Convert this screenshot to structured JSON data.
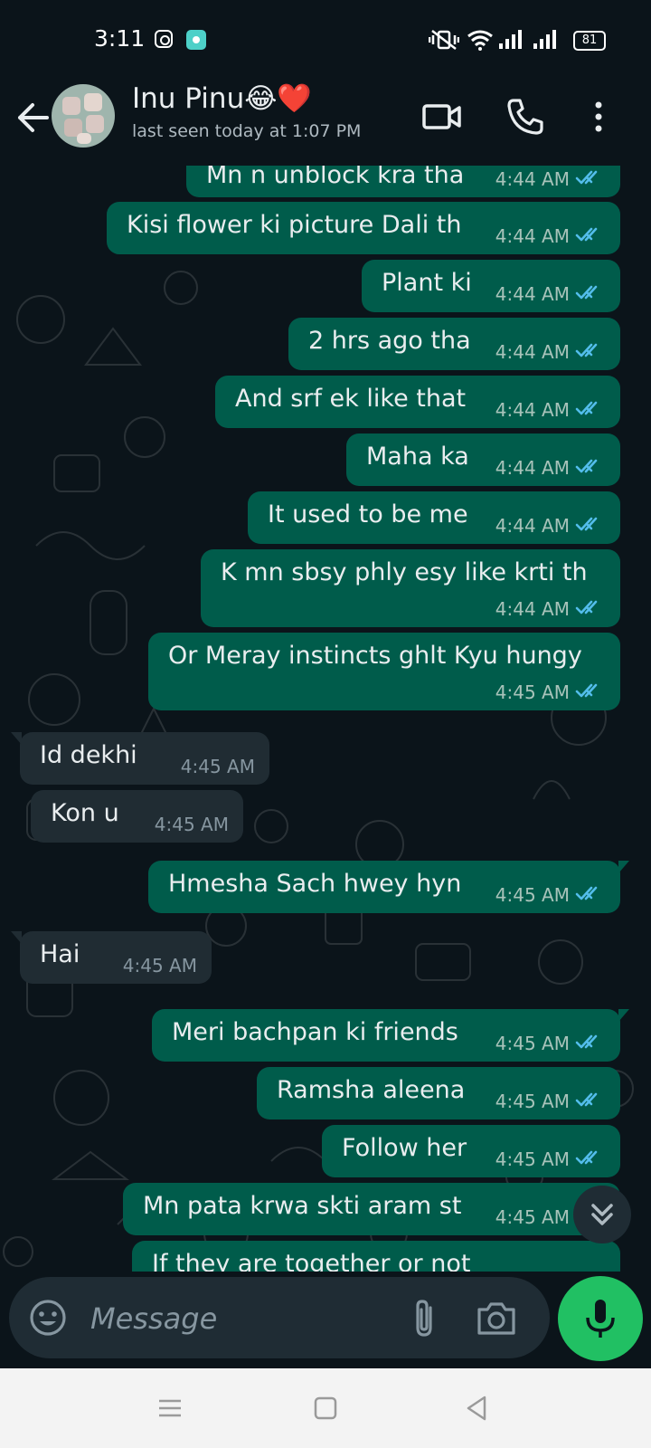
{
  "status_bar": {
    "time": "3:11",
    "battery": "81"
  },
  "header": {
    "name": "Inu Pinu😂❤️",
    "status": "last seen today at 1:07 PM"
  },
  "messages": [
    {
      "dir": "out",
      "text": "Mn n unblock kra tha",
      "time": "4:44 AM"
    },
    {
      "dir": "out",
      "text": "Kisi flower ki picture Dali th",
      "time": "4:44 AM"
    },
    {
      "dir": "out",
      "text": "Plant ki",
      "time": "4:44 AM"
    },
    {
      "dir": "out",
      "text": "2 hrs ago tha",
      "time": "4:44 AM"
    },
    {
      "dir": "out",
      "text": "And srf ek like that",
      "time": "4:44 AM"
    },
    {
      "dir": "out",
      "text": "Maha ka",
      "time": "4:44 AM"
    },
    {
      "dir": "out",
      "text": "It used to be me",
      "time": "4:44 AM"
    },
    {
      "dir": "out",
      "text": "K mn sbsy phly esy like krti th",
      "time": "4:44 AM"
    },
    {
      "dir": "out",
      "text": "Or Meray instincts ghlt Kyu hungy",
      "time": "4:45 AM"
    },
    {
      "dir": "in",
      "text": "Id dekhi",
      "time": "4:45 AM"
    },
    {
      "dir": "in",
      "text": "Kon u",
      "time": "4:45 AM"
    },
    {
      "dir": "out",
      "text": "Hmesha Sach hwey hyn",
      "time": "4:45 AM"
    },
    {
      "dir": "in",
      "text": "Hai",
      "time": "4:45 AM"
    },
    {
      "dir": "out",
      "text": "Meri bachpan ki friends",
      "time": "4:45 AM"
    },
    {
      "dir": "out",
      "text": "Ramsha aleena",
      "time": "4:45 AM"
    },
    {
      "dir": "out",
      "text": "Follow her",
      "time": "4:45 AM"
    },
    {
      "dir": "out",
      "text": "Mn pata krwa skti aram st",
      "time": "4:45 AM"
    },
    {
      "dir": "out",
      "text": "If they are together or not",
      "time": ""
    }
  ],
  "composer": {
    "placeholder": "Message"
  },
  "colors": {
    "outgoing_bubble": "#005c4b",
    "incoming_bubble": "#202c33",
    "read_ticks": "#53bdeb",
    "mic_button": "#21c063"
  },
  "icons": [
    "back-arrow-icon",
    "video-call-icon",
    "voice-call-icon",
    "more-options-icon",
    "emoji-icon",
    "attach-icon",
    "camera-icon",
    "mic-icon",
    "scroll-down-icon",
    "double-tick-icon"
  ]
}
